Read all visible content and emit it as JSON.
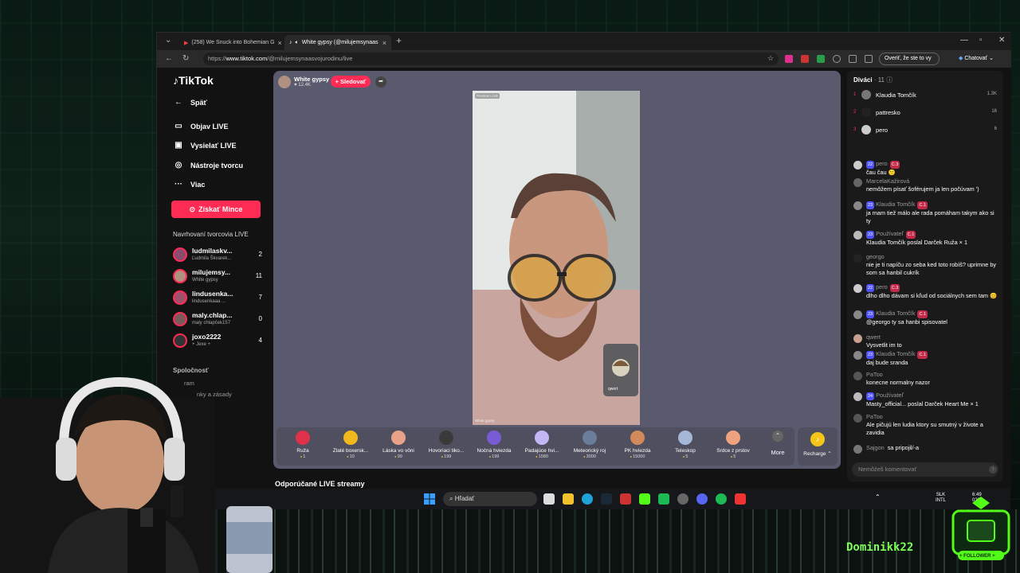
{
  "browser": {
    "tabs": [
      {
        "label": "(258) We Snuck into Bohemian G",
        "active": false
      },
      {
        "label": "White gypsy (@milujemsynaas",
        "active": true
      }
    ],
    "url_prefix": "https://",
    "url_host": "www.tiktok.com",
    "url_path": "/@milujemsynaasvojurodinu/live",
    "verify_label": "Overiť, že ste to vy",
    "chat_label": "Chatovať"
  },
  "sidebar": {
    "logo": "TikTok",
    "back": "Späť",
    "items": [
      {
        "label": "Objav LIVE",
        "icon": "tv-icon"
      },
      {
        "label": "Vysielať LIVE",
        "icon": "camera-icon"
      },
      {
        "label": "Nástroje tvorcu",
        "icon": "lightbulb-icon"
      },
      {
        "label": "Viac",
        "icon": "more-icon"
      }
    ],
    "coins_label": "Získať Mince",
    "suggested_heading": "Navrhovaní tvorcovia LIVE",
    "creators": [
      {
        "name": "ludmilaskv...",
        "sub": "Ľudmila Škvarek...",
        "count": "2"
      },
      {
        "name": "milujemsy...",
        "sub": "White gypsy",
        "count": "11"
      },
      {
        "name": "lindusenka...",
        "sub": "lindusenkaaa ...",
        "count": "7"
      },
      {
        "name": "maly.chlap...",
        "sub": "maly chlapček157",
        "count": "0"
      },
      {
        "name": "joxo2222",
        "sub": "+ Jexe +",
        "count": "4"
      }
    ],
    "company": "Spoločnosť",
    "footer_links": [
      "ram",
      "nky a zásady",
      "kTok"
    ]
  },
  "stage": {
    "host_name": "White gypsy",
    "host_likes": "♥ 12.4K",
    "follow_label": "+ Sledovať",
    "video_label_top": "Preview LIVE",
    "video_label_bottom": "White gypsy",
    "pip_name": "qwert",
    "gifts": [
      {
        "name": "Ruža",
        "price": "1",
        "color": "#e0304a"
      },
      {
        "name": "Zlaté boxersk...",
        "price": "10",
        "color": "#f2b81c"
      },
      {
        "name": "Láska vo vôni",
        "price": "99",
        "color": "#e9a28a"
      },
      {
        "name": "Hovoriaci tiko...",
        "price": "199",
        "color": "#3a3a3a"
      },
      {
        "name": "Nočná hviezda",
        "price": "199",
        "color": "#7a5bd6"
      },
      {
        "name": "Padajúce hvi...",
        "price": "1580",
        "color": "#c2b6f5"
      },
      {
        "name": "Meteorický roj",
        "price": "3000",
        "color": "#6a7d99"
      },
      {
        "name": "PK hviezda",
        "price": "15000",
        "color": "#d28a5a"
      },
      {
        "name": "Teleskop",
        "price": "5",
        "color": "#a6b8d8"
      },
      {
        "name": "Srdce z prstov",
        "price": "5",
        "color": "#f0a27e"
      }
    ],
    "more_label": "More",
    "recharge_label": "Recharge ⌃",
    "recommended": "Odporúčané LIVE streamy"
  },
  "panel": {
    "viewers_label": "Diváci",
    "viewers_count": "· 11",
    "top_viewers": [
      {
        "rank": "1",
        "name": "Klaudia Tomčík",
        "count": "1.3K"
      },
      {
        "rank": "2",
        "name": "pattresko",
        "count": "16"
      },
      {
        "rank": "3",
        "name": "pero",
        "count": "6"
      }
    ],
    "messages": [
      {
        "user": "pero",
        "lvl": "22",
        "club": "C.3",
        "text": "čau čau 🙂"
      },
      {
        "user": "MarcelaKažirová",
        "lvl": "",
        "club": "",
        "text": "nemôžem písať šoférujem ja len počúvam ')"
      },
      {
        "user": "Klaudia Tomčík",
        "lvl": "23",
        "club": "C.1",
        "text": "ja mam tiež málo ale rada pomáham takym ako si ty"
      },
      {
        "user": "Používateľ",
        "lvl": "23",
        "club": "C.1",
        "text": "Klaudia Tomčík poslal Darček Ruža × 1"
      },
      {
        "user": "georgo",
        "lvl": "",
        "club": "",
        "text": "nie je ti napíču zo seba ked toto robíš? uprimne by som sa hanbil cukrík"
      },
      {
        "user": "pero",
        "lvl": "22",
        "club": "C.3",
        "text": "dlho dlho dávam si kľud od sociálnych sem tam 😊"
      },
      {
        "user": "Klaudia Tomčík",
        "lvl": "23",
        "club": "C.1",
        "text": "@georgo ty sa hanbi spisovatel"
      },
      {
        "user": "qwert",
        "lvl": "",
        "club": "",
        "text": "Vysvetlit im to"
      },
      {
        "user": "Klaudia Tomčík",
        "lvl": "23",
        "club": "C.1",
        "text": "daj bude sranda"
      },
      {
        "user": "PaToo",
        "lvl": "",
        "club": "",
        "text": "konecne normalny nazor"
      },
      {
        "user": "Používateľ",
        "lvl": "24",
        "club": "",
        "text": "Masty_official... poslal Darček Heart Me × 1"
      },
      {
        "user": "PaToo",
        "lvl": "",
        "club": "",
        "text": "Ale pičujú len ludia ktory su smutný v živote a zavidia"
      },
      {
        "user": "Sajgon",
        "lvl": "",
        "club": "",
        "text": "sa pripojil/-a"
      }
    ],
    "comment_placeholder": "Nemôžeš komentovať"
  },
  "taskbar": {
    "search_label": "Hľadať",
    "lang_top": "SLK",
    "lang_bottom": "INTL",
    "time": "6:49",
    "date": "026"
  },
  "overlay": {
    "nickname": "Dominikk22",
    "follower_label": "+ FOLLOWER +"
  },
  "colors": {
    "tiktok_red": "#fe2c55",
    "stage": "#5a5a6e",
    "nick_green": "#7cff58"
  }
}
